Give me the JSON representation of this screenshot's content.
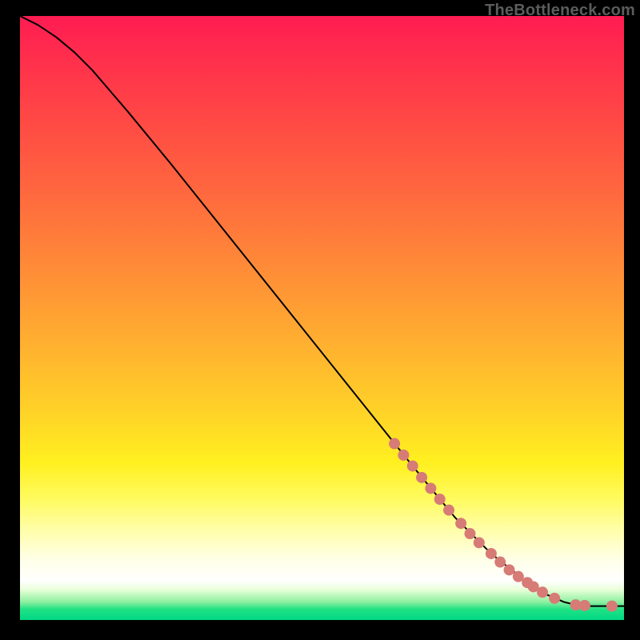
{
  "watermark": "TheBottleneck.com",
  "chart_data": {
    "type": "line",
    "title": "",
    "xlabel": "",
    "ylabel": "",
    "xlim": [
      0,
      100
    ],
    "ylim": [
      0,
      100
    ],
    "grid": false,
    "legend": false,
    "line_color": "#000000",
    "marker_color": "#d77b76",
    "marker_radius": 7,
    "curve": [
      {
        "x": 0,
        "y": 100
      },
      {
        "x": 3,
        "y": 98.5
      },
      {
        "x": 6,
        "y": 96.5
      },
      {
        "x": 9,
        "y": 94
      },
      {
        "x": 12,
        "y": 91
      },
      {
        "x": 18,
        "y": 84
      },
      {
        "x": 25,
        "y": 75.5
      },
      {
        "x": 35,
        "y": 63
      },
      {
        "x": 45,
        "y": 50.5
      },
      {
        "x": 55,
        "y": 38
      },
      {
        "x": 65,
        "y": 25.5
      },
      {
        "x": 72,
        "y": 17
      },
      {
        "x": 78,
        "y": 11
      },
      {
        "x": 83,
        "y": 7
      },
      {
        "x": 87,
        "y": 4.3
      },
      {
        "x": 90,
        "y": 3.0
      },
      {
        "x": 92,
        "y": 2.5
      },
      {
        "x": 94,
        "y": 2.3
      },
      {
        "x": 96,
        "y": 2.3
      },
      {
        "x": 98,
        "y": 2.3
      },
      {
        "x": 100,
        "y": 2.3
      }
    ],
    "markers": [
      {
        "x": 62,
        "y": 29.2
      },
      {
        "x": 63.5,
        "y": 27.3
      },
      {
        "x": 65,
        "y": 25.5
      },
      {
        "x": 66.5,
        "y": 23.6
      },
      {
        "x": 68,
        "y": 21.8
      },
      {
        "x": 69.5,
        "y": 20.0
      },
      {
        "x": 71,
        "y": 18.2
      },
      {
        "x": 73,
        "y": 16.0
      },
      {
        "x": 74.5,
        "y": 14.3
      },
      {
        "x": 76,
        "y": 12.8
      },
      {
        "x": 78,
        "y": 11.0
      },
      {
        "x": 79.5,
        "y": 9.6
      },
      {
        "x": 81,
        "y": 8.3
      },
      {
        "x": 82.5,
        "y": 7.2
      },
      {
        "x": 84,
        "y": 6.2
      },
      {
        "x": 85,
        "y": 5.5
      },
      {
        "x": 86.5,
        "y": 4.6
      },
      {
        "x": 88.5,
        "y": 3.6
      },
      {
        "x": 92,
        "y": 2.5
      },
      {
        "x": 93.5,
        "y": 2.4
      },
      {
        "x": 98,
        "y": 2.3
      }
    ]
  }
}
